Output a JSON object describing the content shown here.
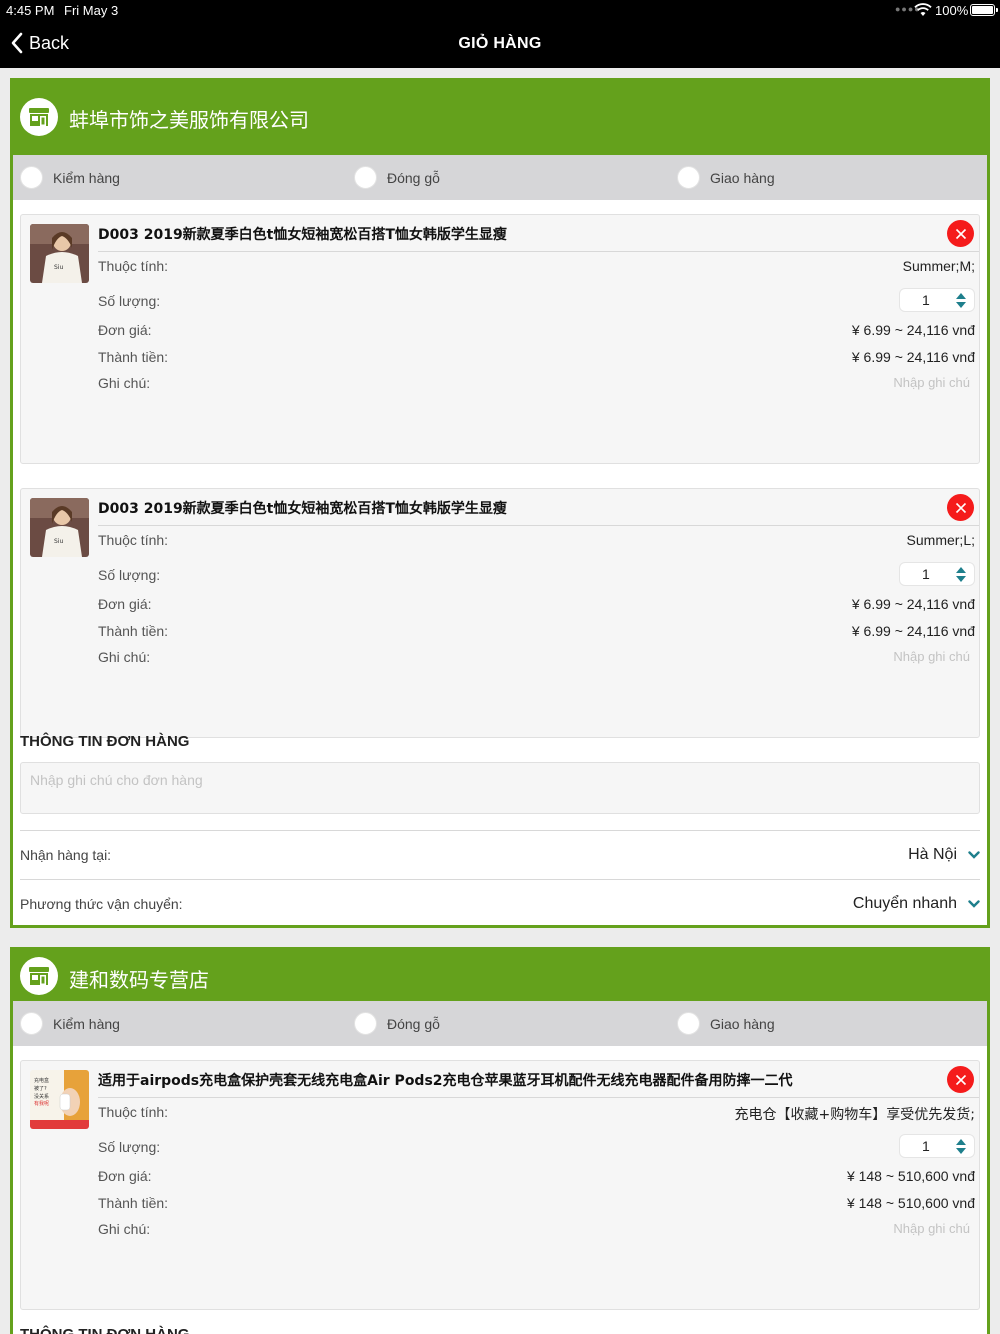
{
  "status_bar": {
    "time": "4:45 PM",
    "date": "Fri May 3",
    "battery": "100%"
  },
  "nav": {
    "back_label": "Back",
    "title": "GIỎ HÀNG"
  },
  "labels": {
    "option_check": "Kiểm hàng",
    "option_pack": "Đóng gỗ",
    "option_deliver": "Giao hàng",
    "attr": "Thuộc tính:",
    "qty": "Số lượng:",
    "price": "Đơn giá:",
    "total": "Thành tiền:",
    "note": "Ghi chú:",
    "note_placeholder": "Nhập ghi chú",
    "order_info": "THÔNG TIN ĐƠN HÀNG",
    "order_note_placeholder": "Nhập ghi chú cho đơn hàng",
    "receive_at": "Nhận hàng tại:",
    "shipping_method": "Phương thức vận chuyển:",
    "order_info_cut": "THÔNG TIN ĐƠN HÀNG"
  },
  "shops": [
    {
      "name": "蚌埠市饰之美服饰有限公司",
      "items": [
        {
          "name": "D003   2019新款夏季白色t恤女短袖宽松百搭T恤女韩版学生显瘦",
          "attr": "Summer;M;",
          "qty": "1",
          "price": "¥ 6.99 ~ 24,116 vnđ",
          "total": "¥ 6.99 ~ 24,116 vnđ"
        },
        {
          "name": "D003   2019新款夏季白色t恤女短袖宽松百搭T恤女韩版学生显瘦",
          "attr": "Summer;L;",
          "qty": "1",
          "price": "¥ 6.99 ~ 24,116 vnđ",
          "total": "¥ 6.99 ~ 24,116 vnđ"
        }
      ],
      "receive_at": "Hà Nội",
      "shipping": "Chuyển nhanh"
    },
    {
      "name": "建和数码专营店",
      "items": [
        {
          "name": "适用于airpods充电盒保护壳套无线充电盒Air Pods2充电仓苹果蓝牙耳机配件无线充电器配件备用防摔一二代",
          "attr": "充电仓【收藏+购物车】享受优先发货;",
          "qty": "1",
          "price": "¥ 148 ~ 510,600 vnđ",
          "total": "¥ 148 ~ 510,600 vnđ"
        }
      ]
    }
  ],
  "colors": {
    "brand_green": "#64a11c",
    "delete_red": "#f51b1b",
    "chevron_teal": "#1e7f8c"
  }
}
